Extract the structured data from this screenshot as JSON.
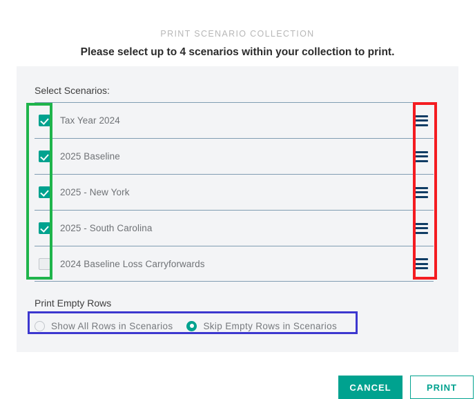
{
  "header": {
    "eyebrow": "PRINT SCENARIO COLLECTION",
    "headline": "Please select up to 4 scenarios within your collection to print."
  },
  "panel": {
    "select_label": "Select Scenarios:",
    "scenarios": [
      {
        "label": "Tax Year 2024",
        "checked": true,
        "handle": "drag-handle-icon"
      },
      {
        "label": "2025 Baseline",
        "checked": true,
        "handle": "drag-handle-icon"
      },
      {
        "label": "2025 - New York",
        "checked": true,
        "handle": "drag-handle-icon"
      },
      {
        "label": "2025 - South Carolina",
        "checked": true,
        "handle": "drag-handle-icon"
      },
      {
        "label": "2024 Baseline Loss Carryforwards",
        "checked": false,
        "handle": "drag-handle-icon"
      }
    ],
    "empty_rows": {
      "label": "Print Empty Rows",
      "options": [
        {
          "label": "Show All Rows in Scenarios",
          "selected": false
        },
        {
          "label": "Skip Empty Rows in Scenarios",
          "selected": true
        }
      ]
    }
  },
  "footer": {
    "cancel_label": "CANCEL",
    "print_label": "PRINT"
  },
  "colors": {
    "accent_teal": "#00a28f",
    "panel_bg": "#f3f4f6",
    "separator": "#7f9cb2",
    "handle": "#0f3c64",
    "anno_green": "#1fb44b",
    "anno_red": "#f41c21",
    "anno_blue": "#3c37cf"
  }
}
